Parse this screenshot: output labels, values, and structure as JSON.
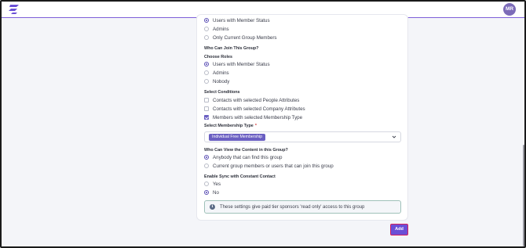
{
  "header": {
    "avatar_initials": "MR"
  },
  "visibility_options": [
    {
      "label": "Users with Member Status",
      "selected": true
    },
    {
      "label": "Admins",
      "selected": false
    },
    {
      "label": "Only Current Group Members",
      "selected": false
    }
  ],
  "who_can_join": {
    "title": "Who Can Join This Group?",
    "roles_label": "Choose Roles",
    "roles": [
      {
        "label": "Users with Member Status",
        "selected": true
      },
      {
        "label": "Admins",
        "selected": false
      },
      {
        "label": "Nobody",
        "selected": false
      }
    ],
    "conditions_label": "Select Conditions",
    "conditions": [
      {
        "label": "Contacts with selected People Attributes",
        "checked": false
      },
      {
        "label": "Contacts with selected Company Attributes",
        "checked": false
      },
      {
        "label": "Members with selected Membership Type",
        "checked": true
      }
    ],
    "membership_type_label": "Select Membership Type",
    "required_marker": "*",
    "membership_type_value": "Individual Free Membership"
  },
  "view_content": {
    "title": "Who Can View the Content in this Group?",
    "options": [
      {
        "label": "Anybody that can find this group",
        "selected": true
      },
      {
        "label": "Current group members or users that can join this group",
        "selected": false
      }
    ]
  },
  "sync": {
    "title": "Enable Sync with Constant Contact",
    "options": [
      {
        "label": "Yes",
        "selected": false
      },
      {
        "label": "No",
        "selected": true
      }
    ]
  },
  "info_message": "These settings give paid tier sponsors 'read only' access to this group",
  "add_button_label": "Add",
  "colors": {
    "accent": "#6a4fd6",
    "focus_border": "#d6205e"
  }
}
